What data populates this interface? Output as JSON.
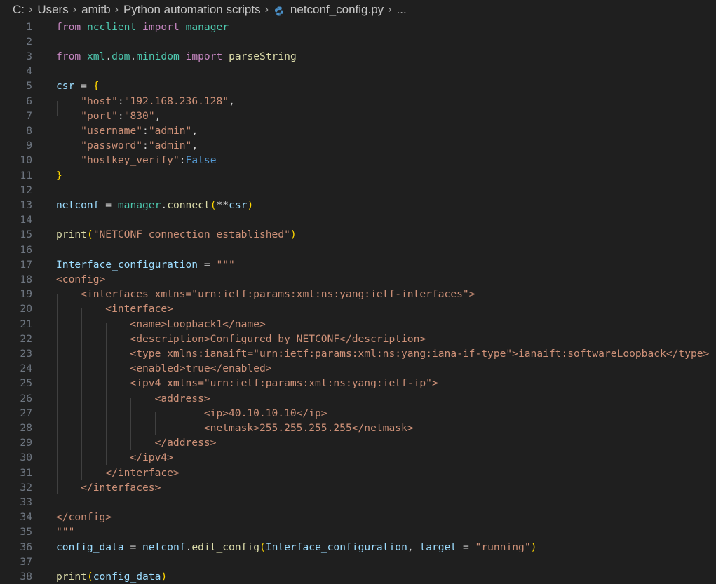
{
  "breadcrumb": {
    "items": [
      "C:",
      "Users",
      "amitb",
      "Python automation scripts",
      "netconf_config.py",
      "..."
    ],
    "icons": [
      "chevron-right-icon",
      "python-file-icon"
    ]
  },
  "editor": {
    "language": "python",
    "theme_colors": {
      "background": "#1f1f1f",
      "keyword": "#c586c0",
      "variable": "#9cdcfe",
      "module": "#4ec9b0",
      "function": "#dcdcaa",
      "string": "#ce9178",
      "constant": "#569cd6",
      "bracket_1": "#ffd700",
      "bracket_2": "#da70d6",
      "bracket_3": "#179fff",
      "line_number": "#6e7681"
    },
    "lines": [
      {
        "n": "1",
        "tokens": [
          [
            "from",
            "kw"
          ],
          [
            " ",
            "op"
          ],
          [
            "ncclient",
            "mod"
          ],
          [
            " ",
            "op"
          ],
          [
            "import",
            "kw"
          ],
          [
            " ",
            "op"
          ],
          [
            "manager",
            "mod"
          ]
        ]
      },
      {
        "n": "2",
        "tokens": []
      },
      {
        "n": "3",
        "tokens": [
          [
            "from",
            "kw"
          ],
          [
            " ",
            "op"
          ],
          [
            "xml",
            "mod"
          ],
          [
            ".",
            "op"
          ],
          [
            "dom",
            "mod"
          ],
          [
            ".",
            "op"
          ],
          [
            "minidom",
            "mod"
          ],
          [
            " ",
            "op"
          ],
          [
            "import",
            "kw"
          ],
          [
            " ",
            "op"
          ],
          [
            "parseString",
            "fn"
          ]
        ]
      },
      {
        "n": "4",
        "tokens": []
      },
      {
        "n": "5",
        "tokens": [
          [
            "csr",
            "var"
          ],
          [
            " = ",
            "op"
          ],
          [
            "{",
            "brace"
          ]
        ]
      },
      {
        "n": "6",
        "tokens": [
          [
            "    ",
            "op"
          ],
          [
            "\"host\"",
            "str"
          ],
          [
            ":",
            "op"
          ],
          [
            "\"192.168.236.128\"",
            "str"
          ],
          [
            ",",
            "op"
          ]
        ]
      },
      {
        "n": "7",
        "tokens": [
          [
            "    ",
            "op"
          ],
          [
            "\"port\"",
            "str"
          ],
          [
            ":",
            "op"
          ],
          [
            "\"830\"",
            "str"
          ],
          [
            ",",
            "op"
          ]
        ]
      },
      {
        "n": "8",
        "tokens": [
          [
            "    ",
            "op"
          ],
          [
            "\"username\"",
            "str"
          ],
          [
            ":",
            "op"
          ],
          [
            "\"admin\"",
            "str"
          ],
          [
            ",",
            "op"
          ]
        ]
      },
      {
        "n": "9",
        "tokens": [
          [
            "    ",
            "op"
          ],
          [
            "\"password\"",
            "str"
          ],
          [
            ":",
            "op"
          ],
          [
            "\"admin\"",
            "str"
          ],
          [
            ",",
            "op"
          ]
        ]
      },
      {
        "n": "10",
        "tokens": [
          [
            "    ",
            "op"
          ],
          [
            "\"hostkey_verify\"",
            "str"
          ],
          [
            ":",
            "op"
          ],
          [
            "False",
            "blue"
          ]
        ]
      },
      {
        "n": "11",
        "tokens": [
          [
            "}",
            "brace"
          ]
        ]
      },
      {
        "n": "12",
        "tokens": []
      },
      {
        "n": "13",
        "tokens": [
          [
            "netconf",
            "var"
          ],
          [
            " = ",
            "op"
          ],
          [
            "manager",
            "mod"
          ],
          [
            ".",
            "op"
          ],
          [
            "connect",
            "fn"
          ],
          [
            "(",
            "brace"
          ],
          [
            "**",
            "op"
          ],
          [
            "csr",
            "var"
          ],
          [
            ")",
            "brace"
          ]
        ]
      },
      {
        "n": "14",
        "tokens": []
      },
      {
        "n": "15",
        "tokens": [
          [
            "print",
            "fn"
          ],
          [
            "(",
            "brace"
          ],
          [
            "\"NETCONF connection established\"",
            "str"
          ],
          [
            ")",
            "brace"
          ]
        ]
      },
      {
        "n": "16",
        "tokens": []
      },
      {
        "n": "17",
        "tokens": [
          [
            "Interface_configuration",
            "var"
          ],
          [
            " = ",
            "op"
          ],
          [
            "\"\"\"",
            "str"
          ]
        ]
      },
      {
        "n": "18",
        "tokens": [
          [
            "<config>",
            "str"
          ]
        ]
      },
      {
        "n": "19",
        "tokens": [
          [
            "    <interfaces xmlns=\"urn:ietf:params:xml:ns:yang:ietf-interfaces\">",
            "str"
          ]
        ]
      },
      {
        "n": "20",
        "tokens": [
          [
            "        <interface>",
            "str"
          ]
        ]
      },
      {
        "n": "21",
        "tokens": [
          [
            "            <name>Loopback1</name>",
            "str"
          ]
        ]
      },
      {
        "n": "22",
        "tokens": [
          [
            "            <description>Configured by NETCONF</description>",
            "str"
          ]
        ]
      },
      {
        "n": "23",
        "tokens": [
          [
            "            <type xmlns:ianaift=\"urn:ietf:params:xml:ns:yang:iana-if-type\">ianaift:softwareLoopback</type>",
            "str"
          ]
        ]
      },
      {
        "n": "24",
        "tokens": [
          [
            "            <enabled>true</enabled>",
            "str"
          ]
        ]
      },
      {
        "n": "25",
        "tokens": [
          [
            "            <ipv4 xmlns=\"urn:ietf:params:xml:ns:yang:ietf-ip\">",
            "str"
          ]
        ]
      },
      {
        "n": "26",
        "tokens": [
          [
            "                <address>",
            "str"
          ]
        ]
      },
      {
        "n": "27",
        "tokens": [
          [
            "                        <ip>40.10.10.10</ip>",
            "str"
          ]
        ]
      },
      {
        "n": "28",
        "tokens": [
          [
            "                        <netmask>255.255.255.255</netmask>",
            "str"
          ]
        ]
      },
      {
        "n": "29",
        "tokens": [
          [
            "                </address>",
            "str"
          ]
        ]
      },
      {
        "n": "30",
        "tokens": [
          [
            "            </ipv4>",
            "str"
          ]
        ]
      },
      {
        "n": "31",
        "tokens": [
          [
            "        </interface>",
            "str"
          ]
        ]
      },
      {
        "n": "32",
        "tokens": [
          [
            "    </interfaces>",
            "str"
          ]
        ]
      },
      {
        "n": "33",
        "tokens": []
      },
      {
        "n": "34",
        "tokens": [
          [
            "</config>",
            "str"
          ]
        ]
      },
      {
        "n": "35",
        "tokens": [
          [
            "\"\"\"",
            "str"
          ]
        ]
      },
      {
        "n": "36",
        "tokens": [
          [
            "config_data",
            "var"
          ],
          [
            " = ",
            "op"
          ],
          [
            "netconf",
            "var"
          ],
          [
            ".",
            "op"
          ],
          [
            "edit_config",
            "fn"
          ],
          [
            "(",
            "brace"
          ],
          [
            "Interface_configuration",
            "var"
          ],
          [
            ", ",
            "op"
          ],
          [
            "target",
            "var"
          ],
          [
            " = ",
            "op"
          ],
          [
            "\"running\"",
            "str"
          ],
          [
            ")",
            "brace"
          ]
        ]
      },
      {
        "n": "37",
        "tokens": []
      },
      {
        "n": "38",
        "tokens": [
          [
            "print",
            "fn"
          ],
          [
            "(",
            "brace"
          ],
          [
            "config_data",
            "var"
          ],
          [
            ")",
            "brace"
          ]
        ]
      }
    ]
  }
}
